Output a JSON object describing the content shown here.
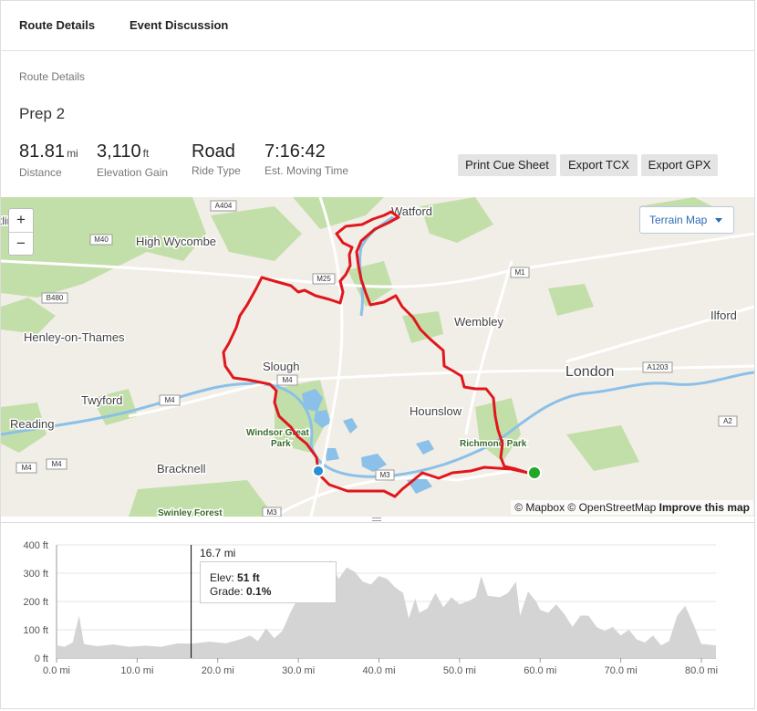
{
  "tabs": [
    "Route Details",
    "Event Discussion"
  ],
  "section_label": "Route Details",
  "route_name": "Prep 2",
  "stats": [
    {
      "value": "81.81",
      "unit": "mi",
      "label": "Distance"
    },
    {
      "value": "3,110",
      "unit": "ft",
      "label": "Elevation Gain"
    },
    {
      "value": "Road",
      "unit": "",
      "label": "Ride Type"
    },
    {
      "value": "7:16:42",
      "unit": "",
      "label": "Est. Moving Time"
    }
  ],
  "buttons": {
    "print": "Print Cue Sheet",
    "tcx": "Export TCX",
    "gpx": "Export GPX"
  },
  "map": {
    "zoom_in": "+",
    "zoom_out": "−",
    "layer_select": "Terrain Map",
    "attribution_1": "© Mapbox © OpenStreetMap",
    "attribution_2": "Improve this map",
    "places": [
      "Watford",
      "High Wycombe",
      "Wembley",
      "Ilford",
      "Henley-on-Thames",
      "Slough",
      "London",
      "Twyford",
      "Hounslow",
      "Reading",
      "Windsor Great",
      "Park",
      "Richmond Park",
      "Bracknell",
      "Swinley Forest",
      "tlin"
    ],
    "roads": [
      "A404",
      "M40",
      "M25",
      "M1",
      "B480",
      "M4",
      "M4",
      "A1203",
      "M4",
      "M4",
      "A2",
      "M3",
      "M3"
    ],
    "colors": {
      "route": "#e0171c",
      "start": "#2a8fd0",
      "end": "#22a828"
    }
  },
  "elevation": {
    "y_ticks": [
      "0 ft",
      "100 ft",
      "200 ft",
      "300 ft",
      "400 ft"
    ],
    "x_ticks": [
      "0.0 mi",
      "10.0 mi",
      "20.0 mi",
      "30.0 mi",
      "40.0 mi",
      "50.0 mi",
      "60.0 mi",
      "70.0 mi",
      "80.0 mi"
    ],
    "ylim": [
      0,
      400
    ],
    "xlim": [
      0,
      81.81
    ],
    "cursor_mi": 16.7,
    "cursor_label": "16.7 mi",
    "tooltip": {
      "elev_label": "Elev:",
      "elev_value": "51 ft",
      "grade_label": "Grade:",
      "grade_value": "0.1%"
    },
    "profile_color": "#d4d4d4",
    "profile": [
      [
        0,
        45
      ],
      [
        1,
        40
      ],
      [
        2,
        55
      ],
      [
        2.8,
        150
      ],
      [
        3.4,
        50
      ],
      [
        5,
        42
      ],
      [
        7,
        48
      ],
      [
        9,
        40
      ],
      [
        11,
        44
      ],
      [
        13,
        40
      ],
      [
        15,
        52
      ],
      [
        16.7,
        51
      ],
      [
        19,
        58
      ],
      [
        21,
        52
      ],
      [
        23,
        68
      ],
      [
        24,
        80
      ],
      [
        25,
        60
      ],
      [
        26,
        105
      ],
      [
        27,
        70
      ],
      [
        28,
        95
      ],
      [
        29,
        160
      ],
      [
        30,
        215
      ],
      [
        31,
        235
      ],
      [
        32,
        280
      ],
      [
        33,
        300
      ],
      [
        34,
        345
      ],
      [
        35,
        280
      ],
      [
        36,
        320
      ],
      [
        37,
        305
      ],
      [
        38,
        270
      ],
      [
        39,
        260
      ],
      [
        40,
        290
      ],
      [
        41,
        280
      ],
      [
        42,
        250
      ],
      [
        43,
        230
      ],
      [
        43.7,
        140
      ],
      [
        44.5,
        210
      ],
      [
        45,
        160
      ],
      [
        46,
        175
      ],
      [
        47,
        230
      ],
      [
        48,
        180
      ],
      [
        49,
        215
      ],
      [
        50,
        190
      ],
      [
        51,
        200
      ],
      [
        52,
        215
      ],
      [
        52.7,
        290
      ],
      [
        53.5,
        220
      ],
      [
        55,
        215
      ],
      [
        56,
        230
      ],
      [
        57,
        270
      ],
      [
        57.5,
        150
      ],
      [
        58.5,
        235
      ],
      [
        59.5,
        200
      ],
      [
        60,
        170
      ],
      [
        61,
        160
      ],
      [
        62,
        190
      ],
      [
        63,
        155
      ],
      [
        64,
        110
      ],
      [
        65,
        150
      ],
      [
        66,
        150
      ],
      [
        67,
        110
      ],
      [
        68,
        95
      ],
      [
        69,
        110
      ],
      [
        70,
        80
      ],
      [
        71,
        100
      ],
      [
        72,
        65
      ],
      [
        73,
        55
      ],
      [
        74,
        80
      ],
      [
        75,
        45
      ],
      [
        76,
        60
      ],
      [
        77,
        150
      ],
      [
        78,
        185
      ],
      [
        79,
        120
      ],
      [
        80,
        50
      ],
      [
        81.81,
        45
      ]
    ]
  }
}
